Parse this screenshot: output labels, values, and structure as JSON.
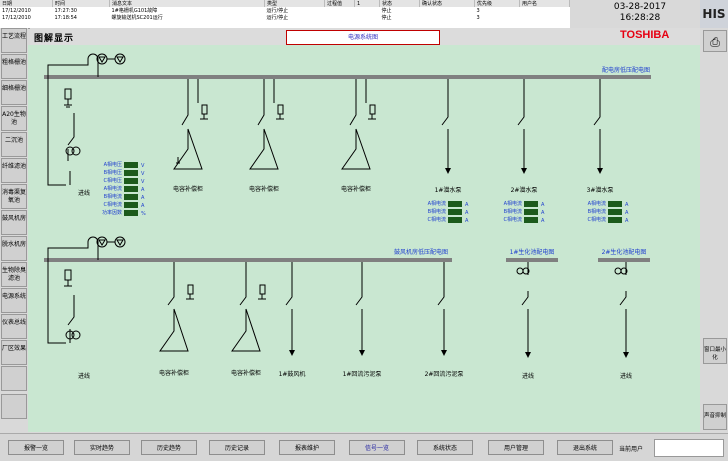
{
  "alarm": {
    "headers": [
      "日期",
      "时间",
      "消息文本",
      "类型",
      "过程值",
      "1",
      "状态",
      "确认状态",
      "优先级",
      "用户名"
    ],
    "rows": [
      [
        "17/12/2010",
        "17:27:30",
        "1#格栅机G101故障",
        "运行/停止",
        "",
        "",
        "停止",
        "",
        "3",
        ""
      ],
      [
        "17/12/2010",
        "17:18:54",
        "螺旋输送机SC201运行",
        "运行/停止",
        "",
        "",
        "停止",
        "",
        "3",
        ""
      ]
    ]
  },
  "clock": {
    "date": "03-28-2017",
    "time": "16:28:28"
  },
  "his_label": "HIS",
  "page_title": "图解显示",
  "diagram_title": "电源系统图",
  "brand": "TOSHIBA",
  "left_nav": [
    "工艺流程",
    "粗格栅池",
    "细格栅池",
    "A20生物池",
    "二沉池",
    "纤维滤池",
    "消毒渠复氧池",
    "鼓风机房",
    "脱水机房",
    "生物除臭滤池",
    "电源系统",
    "仪表总线",
    "厂区效果",
    "",
    ""
  ],
  "right_nav": {
    "window_min": "窗口最小化",
    "sound_mute": "声音抑制"
  },
  "bottom_nav": [
    "报警一览",
    "实时趋势",
    "历史趋势",
    "历史记录",
    "报表维护",
    "信号一览",
    "系统状态",
    "用户管理",
    "退出系统"
  ],
  "current_user_label": "当前用户",
  "diagram": {
    "section1_title": "配电房低压配电图",
    "section2_title": "鼓风机房低压配电图",
    "section3_title": "1#生化池配电图",
    "section4_title": "2#生化池配电图",
    "incoming1": {
      "label": "进线",
      "readings": [
        {
          "name": "A相电压",
          "unit": "V"
        },
        {
          "name": "B相电压",
          "unit": "V"
        },
        {
          "name": "C相电压",
          "unit": "V"
        },
        {
          "name": "A相电流",
          "unit": "A"
        },
        {
          "name": "B相电流",
          "unit": "A"
        },
        {
          "name": "C相电流",
          "unit": "A"
        },
        {
          "name": "功率因数",
          "unit": "%"
        }
      ]
    },
    "cap1": [
      "电容补偿柜",
      "电容补偿柜",
      "电容补偿柜"
    ],
    "pumps": [
      {
        "label": "1#潜水泵"
      },
      {
        "label": "2#潜水泵"
      },
      {
        "label": "3#潜水泵"
      }
    ],
    "pump_readings": [
      {
        "name": "A相电流",
        "unit": "A"
      },
      {
        "name": "B相电流",
        "unit": "A"
      },
      {
        "name": "C相电流",
        "unit": "A"
      }
    ],
    "row2_labels": [
      "进线",
      "电容补偿柜",
      "电容补偿柜",
      "1#鼓风机",
      "1#回流污泥泵",
      "2#回流污泥泵",
      "进线",
      "进线"
    ]
  },
  "colors": {
    "canvas": "#c9e7d1",
    "bus": "#808080",
    "value_box": "#1c5a1c",
    "blue_text": "#1f3fcf",
    "brand": "#e60012"
  }
}
